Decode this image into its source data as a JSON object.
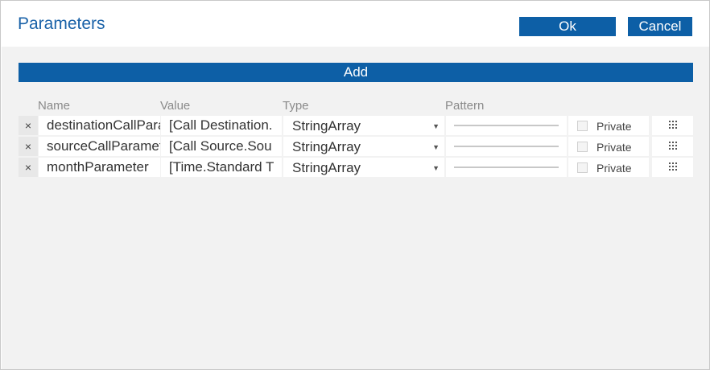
{
  "dialog": {
    "title": "Parameters",
    "ok_label": "Ok",
    "cancel_label": "Cancel"
  },
  "toolbar": {
    "add_label": "Add"
  },
  "columns": {
    "name": "Name",
    "value": "Value",
    "type": "Type",
    "pattern": "Pattern"
  },
  "rows": [
    {
      "remove": "×",
      "name": "destinationCallParameter",
      "value": "[Call Destination.",
      "type": "StringArray",
      "private_label": "Private"
    },
    {
      "remove": "×",
      "name": "sourceCallParameter",
      "value": "[Call Source.Sou",
      "type": "StringArray",
      "private_label": "Private"
    },
    {
      "remove": "×",
      "name": "monthParameter",
      "value": "[Time.Standard T",
      "type": "StringArray",
      "private_label": "Private"
    }
  ],
  "icons": {
    "remove": "close-icon",
    "dropdown": "chevron-down-icon",
    "drag": "drag-handle-icon"
  },
  "colors": {
    "accent": "#0d5fa6",
    "title": "#1a62a8",
    "panel_bg": "#f2f2f2"
  }
}
